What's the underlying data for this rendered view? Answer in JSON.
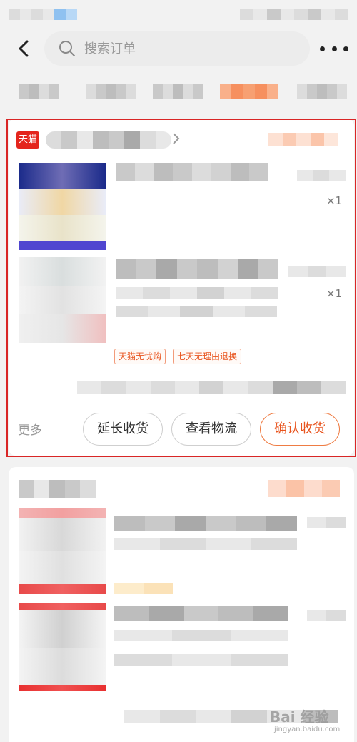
{
  "search": {
    "placeholder": "搜索订单"
  },
  "order_card": {
    "quantity_1": "×1",
    "quantity_2": "×1",
    "tags": [
      "天猫无忧购",
      "七天无理由退换"
    ],
    "more_label": "更多",
    "buttons": {
      "extend_receipt": "延长收货",
      "view_logistics": "查看物流",
      "confirm_receipt": "确认收货"
    }
  },
  "tmall_logo_text": "天猫",
  "watermark": {
    "brand": "Bai 经验",
    "url": "jingyan.baidu.com"
  },
  "colors": {
    "accent": "#e8541e",
    "tmall_red": "#e4251d",
    "highlight_border": "#d92626"
  }
}
